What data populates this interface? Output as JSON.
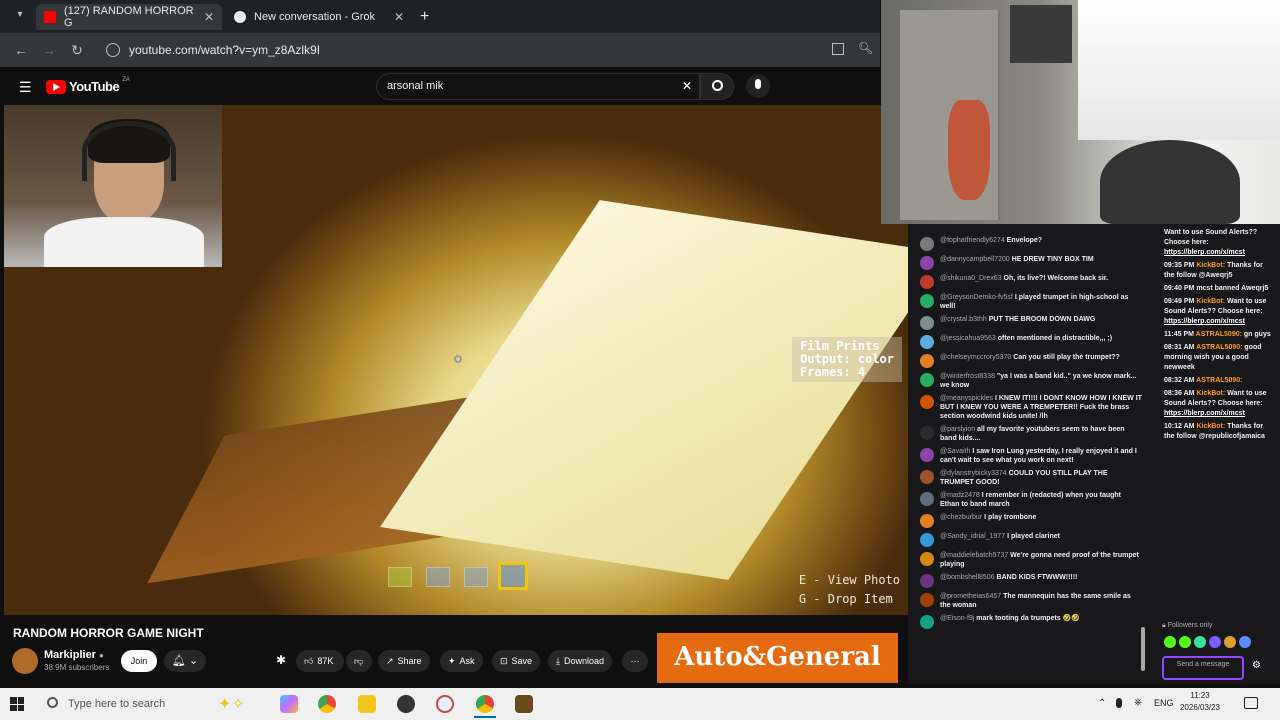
{
  "browser": {
    "tabs": [
      {
        "label": "(127) RANDOM HORROR G",
        "active": true
      },
      {
        "label": "New conversation - Grok",
        "active": false
      }
    ],
    "url": "youtube.com/watch?v=ym_z8Azlk9I"
  },
  "youtube": {
    "logo": "YouTube",
    "country": "ZA",
    "search_value": "arsonal mik"
  },
  "video": {
    "overlay_lines": [
      "Film Prints",
      "Output: color",
      "Frames: 4"
    ],
    "hint_lines": [
      "E - View Photo",
      "G - Drop Item"
    ],
    "title": "RANDOM HORROR GAME NIGHT",
    "channel": "Markiplier",
    "subscribers": "38.9M subscribers",
    "join": "Join",
    "likes": "87K",
    "share": "Share",
    "ask": "Ask",
    "save": "Save",
    "download": "Download",
    "ad_text": "Auto&General"
  },
  "chat": {
    "messages": [
      {
        "user": "@tophatfriendly6274",
        "text": "Envelope?",
        "color": "#7a7a7a"
      },
      {
        "user": "@dannycampbell7200",
        "text": "HE DREW TINY BOX TIM",
        "color": "#8e44ad"
      },
      {
        "user": "@shikuna0_Drex63",
        "text": "Oh, its live?! Welcome back sir.",
        "color": "#c0392b"
      },
      {
        "user": "@GreysonDemko-fv5sf",
        "text": "I played trumpet in high-school as well!",
        "color": "#27ae60"
      },
      {
        "user": "@crystal.b3thh",
        "text": "PUT THE BROOM DOWN DAWG",
        "color": "#7f8c8d"
      },
      {
        "user": "@jessicahua9563",
        "text": "often mentioned in distractible,,, ;)",
        "color": "#5dade2"
      },
      {
        "user": "@chelseymccrory5370",
        "text": "Can you still play the trumpet??",
        "color": "#e67e22"
      },
      {
        "user": "@winterfrost8338",
        "text": "\"ya I was a band kid..\" ya we know mark... we know",
        "color": "#27ae60"
      },
      {
        "user": "@meanyspickles",
        "text": "I KNEW IT!!!! I DONT KNOW HOW I KNEW IT BUT I KNEW YOU WERE A TREMPETER!! Fuck the brass section woodwind kids unite! /lh",
        "color": "#d35400"
      },
      {
        "user": "@parslyion",
        "text": "all my favorite youtubers seem to have been band kids....",
        "color": "#2c2c2c"
      },
      {
        "user": "@Savaith",
        "text": "I saw Iron Lung yesterday, I really enjoyed it and I can't wait to see what you work on next!",
        "color": "#8e44ad"
      },
      {
        "user": "@dylanstrybicky3374",
        "text": "COULD YOU STILL PLAY THE TRUMPET GOOD!",
        "color": "#a0522d"
      },
      {
        "user": "@madz2478",
        "text": "I remember in (redacted) when you taught Ethan to band march",
        "color": "#5d6d7e"
      },
      {
        "user": "@chezburbur",
        "text": "I play trombone",
        "color": "#e67e22"
      },
      {
        "user": "@Sandy_idrial_1977",
        "text": "I played clarinet",
        "color": "#3498db"
      },
      {
        "user": "@maddielebatch5737",
        "text": "We're gonna need proof of the trumpet playing",
        "color": "#d68910"
      },
      {
        "user": "@bombshell8506",
        "text": "BAND KIDS FTWWW!!!!!",
        "color": "#6c3483"
      },
      {
        "user": "@prometheias6457",
        "text": "The mannequin has the same smile as the woman",
        "color": "#a04000"
      },
      {
        "user": "@Eison-f9j",
        "text": "mark tooting da trumpets 🤣🤣",
        "color": "#16a085"
      }
    ]
  },
  "chat2": {
    "entries": [
      {
        "time": "",
        "user": "",
        "text": "Want to use Sound Alerts?? Choose here:",
        "link": "https://blerp.com/x/mcst"
      },
      {
        "time": "09:35 PM",
        "user": "KickBot:",
        "text": "Thanks for the follow @Aweqrj5",
        "link": ""
      },
      {
        "time": "09:40 PM",
        "user": "",
        "text": "mcst banned Aweqrj5",
        "link": ""
      },
      {
        "time": "09:49 PM",
        "user": "KickBot:",
        "text": "Want to use Sound Alerts?? Choose here:",
        "link": "https://blerp.com/x/mcst"
      },
      {
        "time": "11:45 PM",
        "user": "ASTRAL5090:",
        "text": "gn guys",
        "link": ""
      },
      {
        "time": "08:31 AM",
        "user": "ASTRAL5090:",
        "text": "good morning wish you a good newweek",
        "link": ""
      },
      {
        "time": "08:32 AM",
        "user": "ASTRAL5090:",
        "text": "",
        "link": ""
      },
      {
        "time": "08:36 AM",
        "user": "KickBot:",
        "text": "Want to use Sound Alerts?? Choose here:",
        "link": "https://blerp.com/x/mcst"
      },
      {
        "time": "10:12 AM",
        "user": "KickBot:",
        "text": "Thanks for the follow @republicofjamaica",
        "link": ""
      }
    ],
    "followers_only": "Followers only",
    "send": "Send a message"
  },
  "taskbar": {
    "search_placeholder": "Type here to search",
    "lang": "ENG",
    "time": "11:23",
    "date": "2026/03/23"
  }
}
